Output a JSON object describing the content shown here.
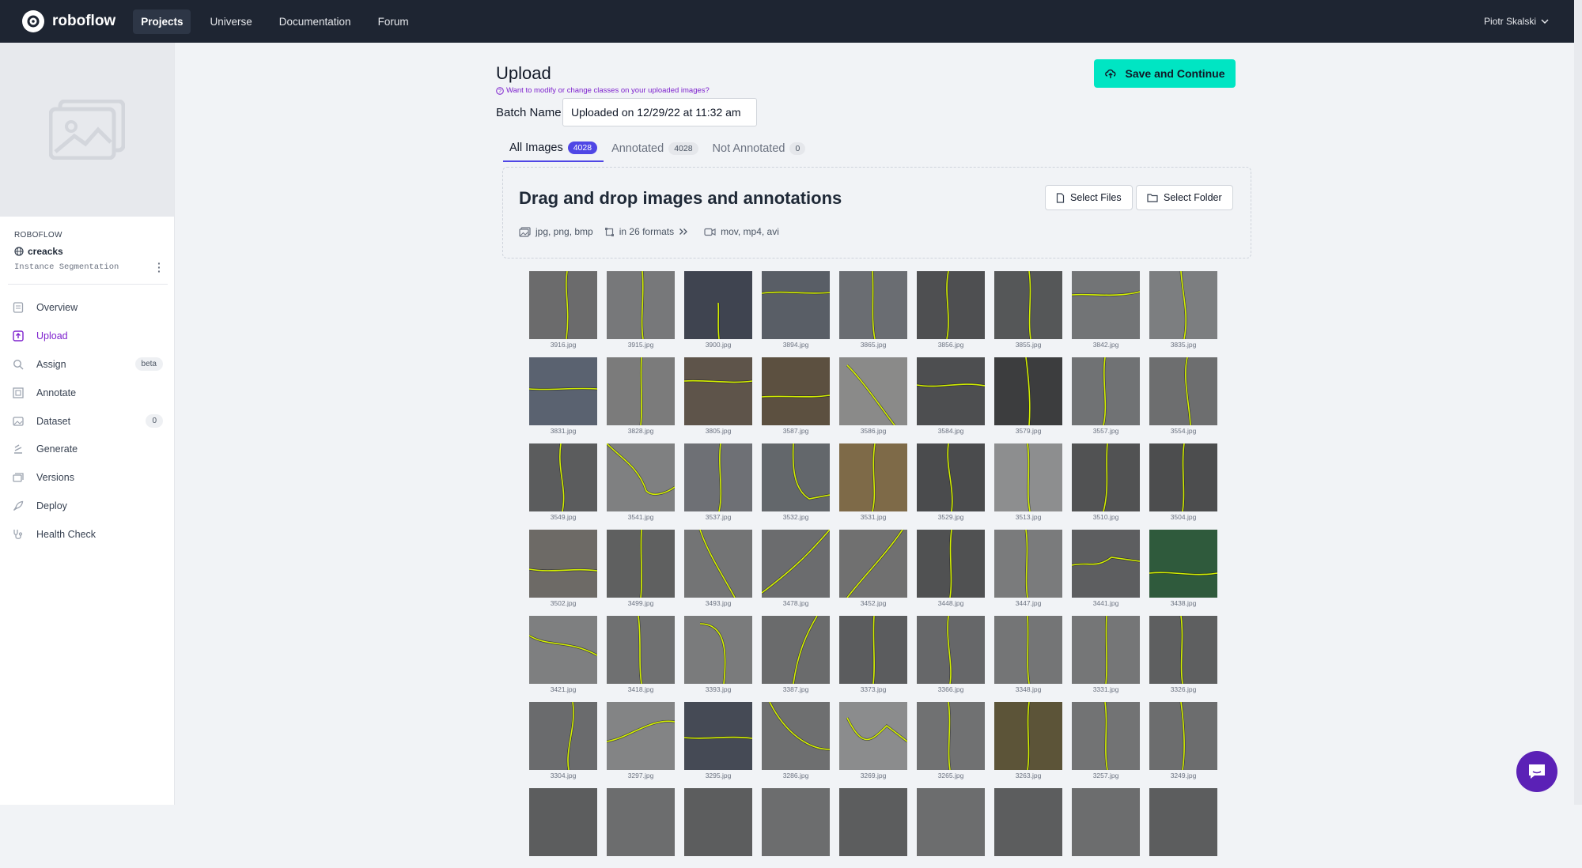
{
  "app": {
    "brand": "roboflow",
    "accent": "#00e5c3",
    "purple": "#7e22ce"
  },
  "nav": {
    "items": [
      "Projects",
      "Universe",
      "Documentation",
      "Forum"
    ],
    "active": "Projects",
    "user": "Piotr Skalski"
  },
  "sidebar": {
    "org": "ROBOFLOW",
    "project": "creacks",
    "project_type": "Instance Segmentation",
    "items": [
      {
        "label": "Overview",
        "icon": "overview-icon"
      },
      {
        "label": "Upload",
        "icon": "upload-icon",
        "active": true
      },
      {
        "label": "Assign",
        "icon": "search-icon",
        "badge": "beta"
      },
      {
        "label": "Annotate",
        "icon": "annotate-icon"
      },
      {
        "label": "Dataset",
        "icon": "dataset-icon",
        "badge": "0"
      },
      {
        "label": "Generate",
        "icon": "generate-icon"
      },
      {
        "label": "Versions",
        "icon": "versions-icon"
      },
      {
        "label": "Deploy",
        "icon": "rocket-icon"
      },
      {
        "label": "Health Check",
        "icon": "stethoscope-icon"
      }
    ]
  },
  "main": {
    "title": "Upload",
    "hint": "Want to modify or change classes on your uploaded images?",
    "save_label": "Save and Continue",
    "batch_label": "Batch Name",
    "batch_value": "Uploaded on 12/29/22 at 11:32 am",
    "tabs": [
      {
        "label": "All Images",
        "count": "4028",
        "active": true
      },
      {
        "label": "Annotated",
        "count": "4028"
      },
      {
        "label": "Not Annotated",
        "count": "0"
      }
    ],
    "drop": {
      "title": "Drag and drop images and annotations",
      "image_formats": "jpg, png, bmp",
      "annotation_formats": "in 26 formats",
      "video_formats": "mov, mp4, avi",
      "select_files": "Select Files",
      "select_folder": "Select Folder"
    },
    "images": [
      "3916.jpg",
      "3915.jpg",
      "3900.jpg",
      "3894.jpg",
      "3865.jpg",
      "3856.jpg",
      "3855.jpg",
      "3842.jpg",
      "3835.jpg",
      "3831.jpg",
      "3828.jpg",
      "3805.jpg",
      "3587.jpg",
      "3586.jpg",
      "3584.jpg",
      "3579.jpg",
      "3557.jpg",
      "3554.jpg",
      "3549.jpg",
      "3541.jpg",
      "3537.jpg",
      "3532.jpg",
      "3531.jpg",
      "3529.jpg",
      "3513.jpg",
      "3510.jpg",
      "3504.jpg",
      "3502.jpg",
      "3499.jpg",
      "3493.jpg",
      "3478.jpg",
      "3452.jpg",
      "3448.jpg",
      "3447.jpg",
      "3441.jpg",
      "3438.jpg",
      "3421.jpg",
      "3418.jpg",
      "3393.jpg",
      "3387.jpg",
      "3373.jpg",
      "3366.jpg",
      "3348.jpg",
      "3331.jpg",
      "3326.jpg",
      "3304.jpg",
      "3297.jpg",
      "3295.jpg",
      "3286.jpg",
      "3269.jpg",
      "3265.jpg",
      "3263.jpg",
      "3257.jpg",
      "3249.jpg",
      "",
      "",
      "",
      "",
      "",
      "",
      "",
      "",
      ""
    ]
  }
}
